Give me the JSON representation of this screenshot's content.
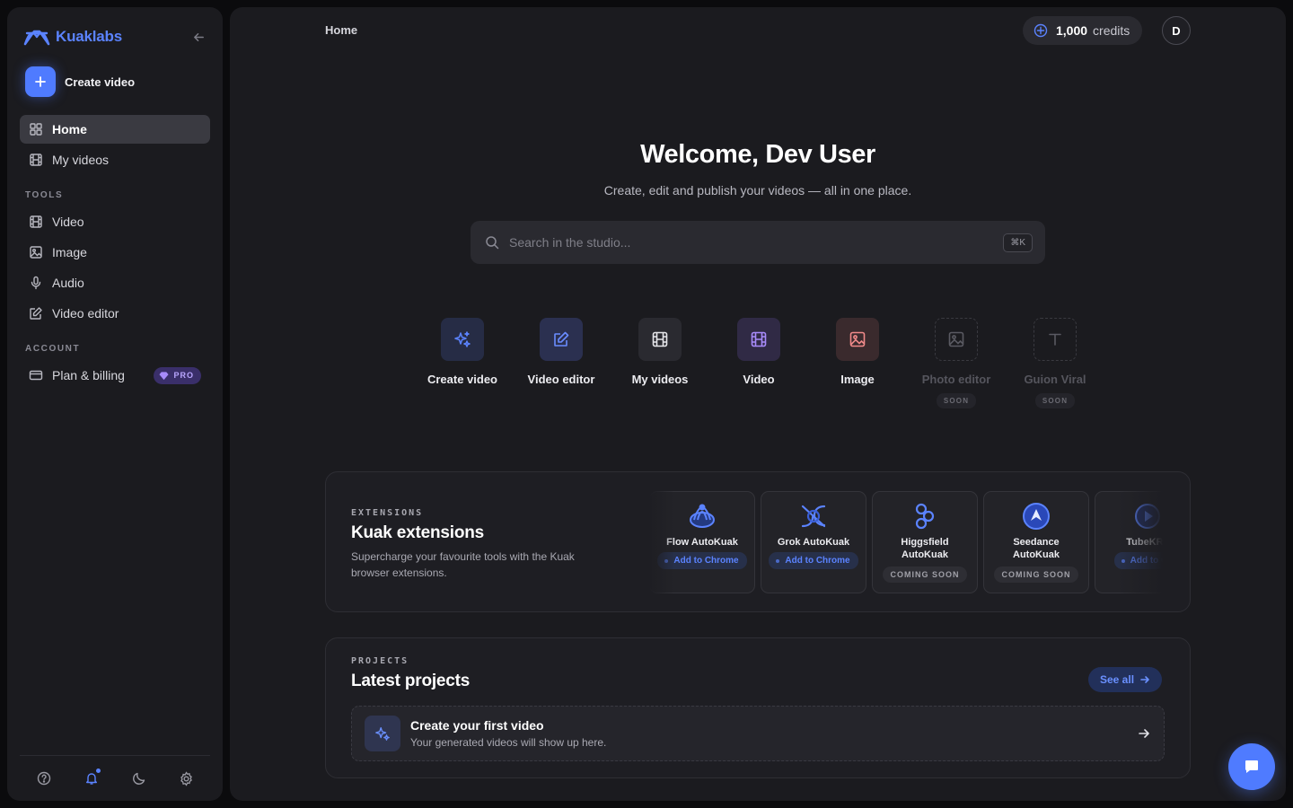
{
  "brand": {
    "name": "Kuaklabs",
    "color": "#5b83ff"
  },
  "sidebar": {
    "create_label": "Create video",
    "nav": [
      {
        "label": "Home",
        "icon": "grid-icon",
        "active": true
      },
      {
        "label": "My videos",
        "icon": "film-icon"
      }
    ],
    "tools_heading": "TOOLS",
    "tools": [
      {
        "label": "Video",
        "icon": "film-icon"
      },
      {
        "label": "Image",
        "icon": "image-icon"
      },
      {
        "label": "Audio",
        "icon": "microphone-icon"
      },
      {
        "label": "Video editor",
        "icon": "edit-icon"
      }
    ],
    "account_heading": "ACCOUNT",
    "account": [
      {
        "label": "Plan & billing",
        "icon": "credit-card-icon",
        "badge": "PRO"
      }
    ],
    "footer_icons": [
      "help-icon",
      "bell-icon",
      "moon-icon",
      "settings-icon"
    ]
  },
  "header": {
    "breadcrumb": "Home",
    "credits_value": "1,000",
    "credits_label": "credits",
    "avatar_initial": "D"
  },
  "hero": {
    "title": "Welcome, Dev User",
    "subtitle": "Create, edit and publish your videos — all in one place.",
    "search_placeholder": "Search in the studio...",
    "search_shortcut": "⌘K"
  },
  "quick_tools": [
    {
      "label": "Create video",
      "icon": "sparkles-icon",
      "color": "#5b83ff"
    },
    {
      "label": "Video editor",
      "icon": "edit-icon",
      "color": "#6a8cff"
    },
    {
      "label": "My videos",
      "icon": "film-icon",
      "color": "#e6e6ea"
    },
    {
      "label": "Video",
      "icon": "film-icon",
      "color": "#a78bfa"
    },
    {
      "label": "Image",
      "icon": "image-icon",
      "color": "#f08a8a"
    },
    {
      "label": "Photo editor",
      "icon": "image-icon",
      "soon": "SOON"
    },
    {
      "label": "Guion Viral",
      "icon": "text-icon",
      "soon": "SOON"
    }
  ],
  "extensions": {
    "eyebrow": "EXTENSIONS",
    "title": "Kuak extensions",
    "description": "Supercharge your favourite tools with the Kuak browser extensions.",
    "items": [
      {
        "name": "Flow AutoKuak",
        "action": "Add to Chrome",
        "icon": "flow-logo-icon"
      },
      {
        "name": "Grok AutoKuak",
        "action": "Add to Chrome",
        "icon": "grok-logo-icon"
      },
      {
        "name": "Higgsfield AutoKuak",
        "status": "COMING SOON",
        "icon": "higgsfield-logo-icon"
      },
      {
        "name": "Seedance AutoKuak",
        "status": "COMING SOON",
        "icon": "seedance-logo-icon"
      },
      {
        "name": "TubeKRa",
        "action": "Add to Ch",
        "icon": "tube-logo-icon"
      }
    ]
  },
  "projects": {
    "eyebrow": "PROJECTS",
    "title": "Latest projects",
    "see_all": "See all",
    "empty_title": "Create your first video",
    "empty_subtitle": "Your generated videos will show up here."
  }
}
